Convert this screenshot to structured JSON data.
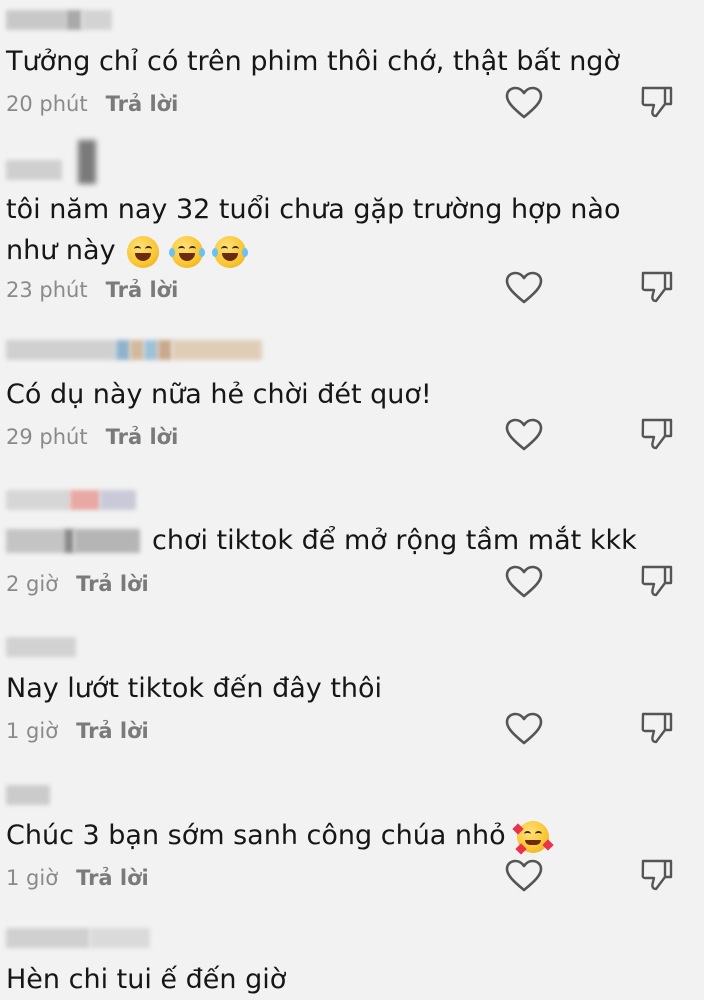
{
  "comments": [
    {
      "text": "Tưởng chỉ có trên phim thôi chớ, thật bất ngờ",
      "time": "20 phút",
      "reply_label": "Trả lời"
    },
    {
      "text_line1": "tôi năm nay 32 tuổi chưa gặp trường hợp nào",
      "text_line2": "như này",
      "emojis": [
        "grinning-face-emoji",
        "tears-of-joy-emoji",
        "tears-of-joy-emoji"
      ],
      "time": "23 phút",
      "reply_label": "Trả lời"
    },
    {
      "text": "Có dụ này nữa hẻ chời đét quơ!",
      "time": "29 phút",
      "reply_label": "Trả lời"
    },
    {
      "text": "chơi tiktok để mở rộng tầm mắt kkk",
      "time": "2 giờ",
      "reply_label": "Trả lời"
    },
    {
      "text": "Nay lướt tiktok đến đây thôi",
      "time": "1 giờ",
      "reply_label": "Trả lời"
    },
    {
      "text": "Chúc 3 bạn sớm sanh công chúa nhỏ",
      "emojis": [
        "smiling-face-with-hearts-emoji"
      ],
      "time": "1 giờ",
      "reply_label": "Trả lời"
    },
    {
      "text": "Hèn chi tui ế đến giờ"
    }
  ],
  "colors": {
    "background": "#f2f2f2",
    "text": "#161616",
    "meta": "#8a8a8a",
    "icon_stroke": "#555555"
  }
}
